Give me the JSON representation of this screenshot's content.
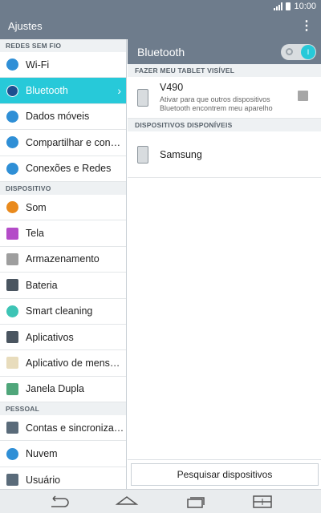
{
  "status": {
    "time": "10:00"
  },
  "appbar": {
    "title": "Ajustes",
    "more_icon": "more-vert-icon"
  },
  "sidebar": {
    "sections": [
      {
        "title": "REDES SEM FIO",
        "items": [
          {
            "label": "Wi-Fi",
            "icon": "wifi-icon",
            "color": "#2f8fd6"
          },
          {
            "label": "Bluetooth",
            "icon": "bluetooth-icon",
            "color": "#1d4e8f",
            "active": true
          },
          {
            "label": "Dados móveis",
            "icon": "mobile-data-icon",
            "color": "#2f8fd6"
          },
          {
            "label": "Compartilhar e con…",
            "icon": "share-icon",
            "color": "#2f8fd6"
          },
          {
            "label": "Conexões e Redes",
            "icon": "network-icon",
            "color": "#2f8fd6"
          }
        ]
      },
      {
        "title": "DISPOSITIVO",
        "items": [
          {
            "label": "Som",
            "icon": "sound-icon",
            "color": "#e98a1d"
          },
          {
            "label": "Tela",
            "icon": "display-icon",
            "color": "#b44cc8"
          },
          {
            "label": "Armazenamento",
            "icon": "storage-icon",
            "color": "#9e9e9e"
          },
          {
            "label": "Bateria",
            "icon": "battery-icon",
            "color": "#4a5560"
          },
          {
            "label": "Smart cleaning",
            "icon": "smart-cleaning-icon",
            "color": "#3dc4b5"
          },
          {
            "label": "Aplicativos",
            "icon": "apps-icon",
            "color": "#4a5560"
          },
          {
            "label": "Aplicativo de mens…",
            "icon": "messaging-icon",
            "color": "#e8dcbc"
          },
          {
            "label": "Janela Dupla",
            "icon": "dual-window-icon",
            "color": "#4fa67a"
          }
        ]
      },
      {
        "title": "PESSOAL",
        "items": [
          {
            "label": "Contas e sincroniza…",
            "icon": "accounts-icon",
            "color": "#5a6b7a"
          },
          {
            "label": "Nuvem",
            "icon": "cloud-icon",
            "color": "#2f8fd6"
          },
          {
            "label": "Usuário",
            "icon": "user-icon",
            "color": "#5a6b7a"
          }
        ]
      }
    ]
  },
  "bluetooth": {
    "title": "Bluetooth",
    "toggle_on": true,
    "visible_section": "FAZER MEU TABLET VISÍVEL",
    "own_device": {
      "name": "V490",
      "description": "Ativar para que outros dispositivos Bluetooth encontrem meu aparelho",
      "checked": false
    },
    "available_section": "DISPOSITIVOS DISPONÍVEIS",
    "devices": [
      {
        "name": "Samsung"
      }
    ],
    "search_button": "Pesquisar dispositivos"
  },
  "navbar": {
    "back_icon": "back-icon",
    "home_icon": "home-icon",
    "recents_icon": "recent-apps-icon",
    "dual_window_icon": "dual-window-nav-icon"
  }
}
